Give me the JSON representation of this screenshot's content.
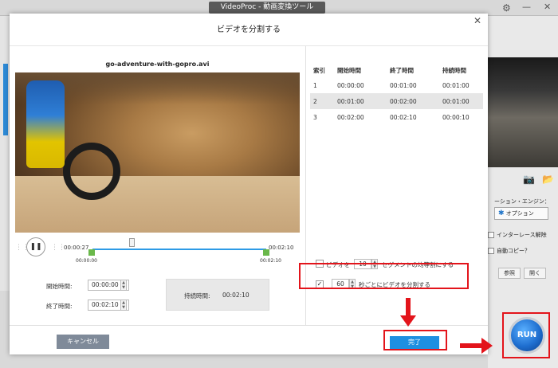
{
  "app": {
    "window_title": "VideoProc - 動画変換ツール",
    "icons": [
      "gear-icon",
      "minimize-icon",
      "close-icon"
    ]
  },
  "background": {
    "engine_label": "ーション・エンジン：",
    "option_label": "オプション",
    "deinterlace_label": "インターレース解除",
    "autocopy_label": "自動コピー？",
    "ref_label": "参照",
    "open_label": "開く",
    "icons": [
      "camera-icon",
      "folder-icon"
    ]
  },
  "dialog": {
    "title": "ビデオを分割する",
    "close_symbol": "✕",
    "filename": "go-adventure-with-gopro.avi",
    "timeline": {
      "current_time": "00:00:27",
      "end_time": "00:02:10",
      "range_start": "00:00:00",
      "range_end": "00:02:10",
      "playhead_fraction": 0.23
    },
    "start_label": "開始時間:",
    "start_value": "00:00:00",
    "end_label": "終了時間:",
    "end_value": "00:02:10",
    "duration_label": "持続時間:",
    "duration_value": "00:02:10",
    "segments": {
      "headers": [
        "索引",
        "開始時間",
        "終了時間",
        "持続時間"
      ],
      "rows": [
        [
          "1",
          "00:00:00",
          "00:01:00",
          "00:01:00"
        ],
        [
          "2",
          "00:01:00",
          "00:02:00",
          "00:01:00"
        ],
        [
          "3",
          "00:02:00",
          "00:02:10",
          "00:00:10"
        ]
      ],
      "selected_row": 2
    },
    "option_equal": {
      "prefix": "ビデオを",
      "value": "10",
      "suffix": "セグメントの均等割にする",
      "checked": false
    },
    "option_seconds": {
      "value": "60",
      "suffix": "秒ごとにビデオを分割する",
      "checked": true
    },
    "cancel_label": "キャンセル",
    "done_label": "完了"
  },
  "run_label": "RUN",
  "colors": {
    "accent": "#1e8fe1",
    "highlight": "#e3141b",
    "marker": "#6ab84a",
    "track": "#2d9be6"
  }
}
